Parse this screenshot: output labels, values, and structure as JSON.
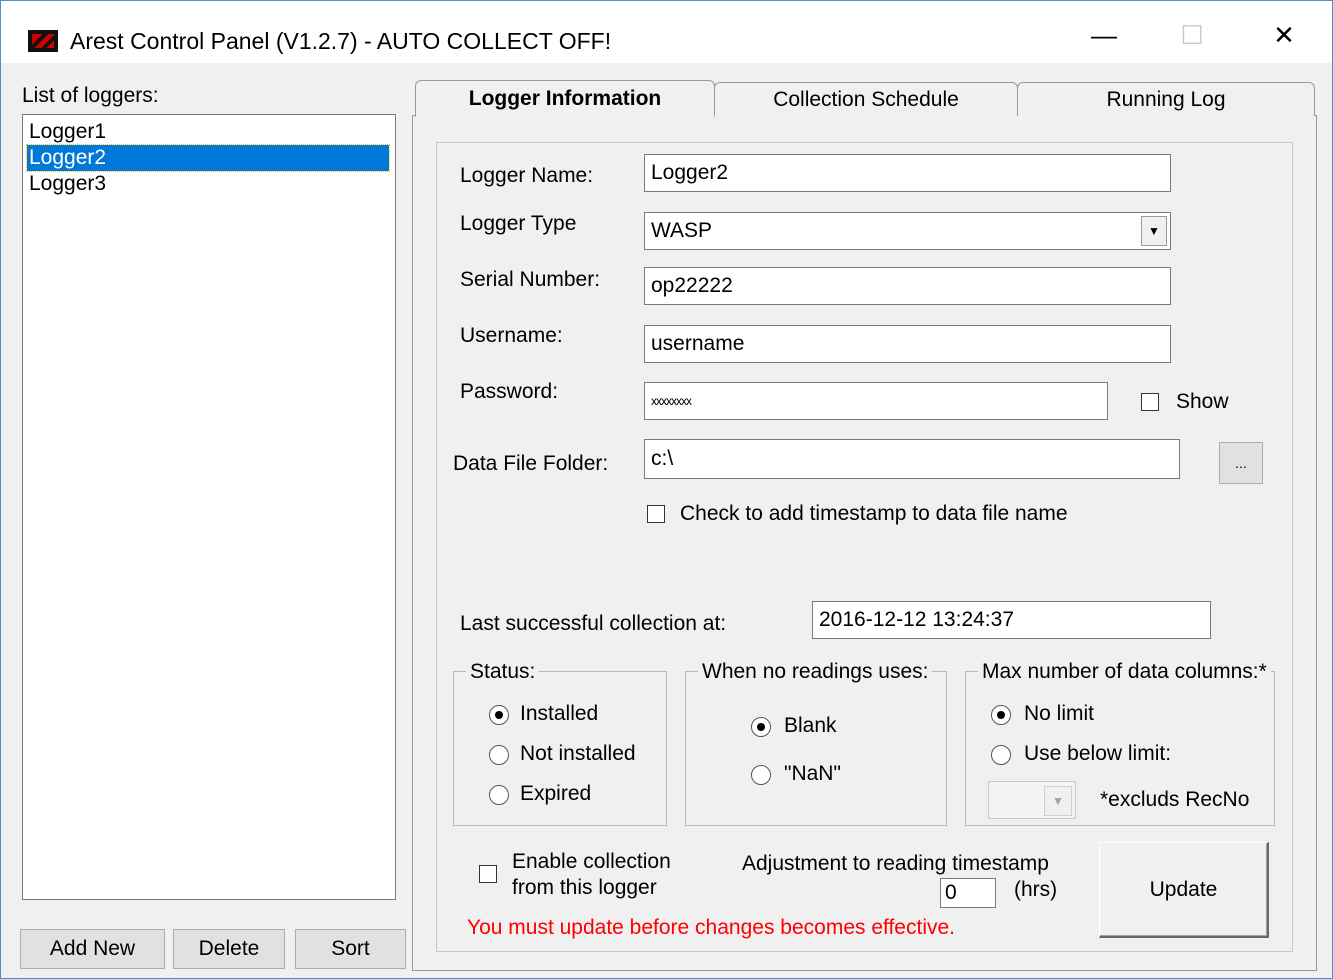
{
  "window": {
    "title": "Arest Control Panel  (V1.2.7) - AUTO COLLECT OFF!",
    "minimize": "—",
    "maximize": "☐",
    "close": "✕"
  },
  "loggers": {
    "label": "List of loggers:",
    "items": [
      "Logger1",
      "Logger2",
      "Logger3"
    ],
    "selected": "Logger2",
    "add_new": "Add New",
    "delete": "Delete",
    "sort": "Sort"
  },
  "tabs": [
    "Logger Information",
    "Collection Schedule",
    "Running Log"
  ],
  "active_tab": "Logger Information",
  "form": {
    "logger_name_label": "Logger Name:",
    "logger_name": "Logger2",
    "logger_type_label": "Logger Type",
    "logger_type": "WASP",
    "serial_label": "Serial Number:",
    "serial": "op22222",
    "username_label": "Username:",
    "username": "username",
    "password_label": "Password:",
    "password": "xxxxxxxx",
    "show_label": "Show",
    "show_checked": false,
    "folder_label": "Data File Folder:",
    "folder": "c:\\",
    "browse": "...",
    "timestamp_label": "Check to add timestamp to data file name",
    "timestamp_checked": false,
    "last_label": "Last successful collection at:",
    "last_value": "2016-12-12 13:24:37"
  },
  "status_group": {
    "legend": "Status:",
    "options": [
      "Installed",
      "Not installed",
      "Expired"
    ],
    "selected": "Installed"
  },
  "readings_group": {
    "legend": "When no readings uses:",
    "options": [
      "Blank",
      "\"NaN\""
    ],
    "selected": "Blank"
  },
  "columns_group": {
    "legend": "Max number of data columns:*",
    "options": [
      "No limit",
      "Use below limit:"
    ],
    "selected": "No limit",
    "note": "*excluds RecNo"
  },
  "footer": {
    "enable_label_1": "Enable collection",
    "enable_label_2": "from this logger",
    "enable_checked": false,
    "adjust_label": "Adjustment to reading timestamp",
    "adjust_value": "0",
    "adjust_unit": "(hrs)",
    "update": "Update",
    "warning": "You must update before changes becomes effective."
  },
  "colors": {
    "selection": "#0078d7",
    "warning": "#ff0000",
    "window_border": "#4a90d9"
  }
}
